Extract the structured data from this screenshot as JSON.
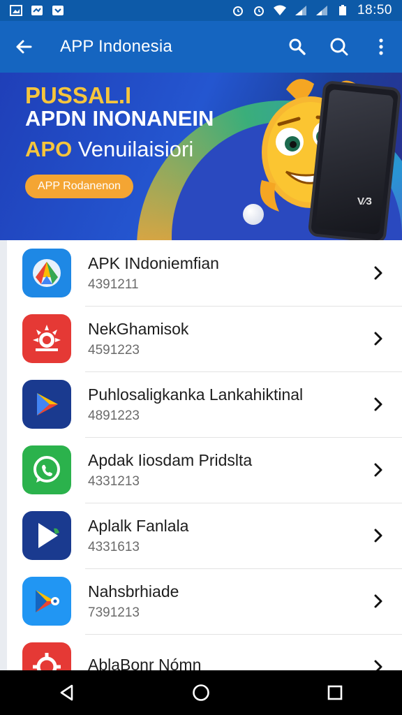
{
  "status_bar": {
    "time": "18:50",
    "left_icons": [
      "image-icon",
      "call-missed-icon",
      "download-icon"
    ],
    "right_icons": [
      "alarm-icon",
      "alarm-icon",
      "wifi-icon",
      "signal-icon",
      "signal-icon",
      "battery-icon"
    ]
  },
  "app_bar": {
    "title": "APP Indonesia",
    "actions": [
      "search-icon",
      "search-icon",
      "more-vert-icon"
    ]
  },
  "banner": {
    "line1": "PUSSAL.I",
    "line2": "APDN INONANEIN",
    "line3_accent": "APO",
    "line3_rest": " Venuilaisiori",
    "button_label": "APP Rodanenon",
    "phone_text": "V⁄3"
  },
  "list": {
    "items": [
      {
        "title": "APK INdoniemfian",
        "subtitle": "4391211",
        "icon": "blue-diamond-app-icon",
        "icon_bg": "#1e88e5"
      },
      {
        "title": "NekGhamisok",
        "subtitle": "4591223",
        "icon": "red-sun-app-icon",
        "icon_bg": "#e53935"
      },
      {
        "title": "Puhlosaligkanka Lankahiktinal",
        "subtitle": "4891223",
        "icon": "play-triangle-app-icon",
        "icon_bg": "#1a3a8f"
      },
      {
        "title": "Apdak Iiosdam Pridslta",
        "subtitle": "4331213",
        "icon": "whatsapp-app-icon",
        "icon_bg": "#2bb24c"
      },
      {
        "title": "Aplalk Fanlala",
        "subtitle": "4331613",
        "icon": "play-app-icon",
        "icon_bg": "#1a3a8f"
      },
      {
        "title": "Nahsbrhiade",
        "subtitle": "7391213",
        "icon": "play-store-app-icon",
        "icon_bg": "#2196f3"
      },
      {
        "title": "AblaBonr Nómn",
        "subtitle": "",
        "icon": "red-gear-app-icon",
        "icon_bg": "#e53935"
      }
    ]
  },
  "nav_bar": {
    "buttons": [
      "back-triangle-icon",
      "home-circle-icon",
      "recents-square-icon"
    ]
  },
  "colors": {
    "status_bar": "#0d5aa8",
    "app_bar": "#1565c0",
    "banner_accent": "#f6c53c",
    "banner_button": "#f4a533"
  }
}
